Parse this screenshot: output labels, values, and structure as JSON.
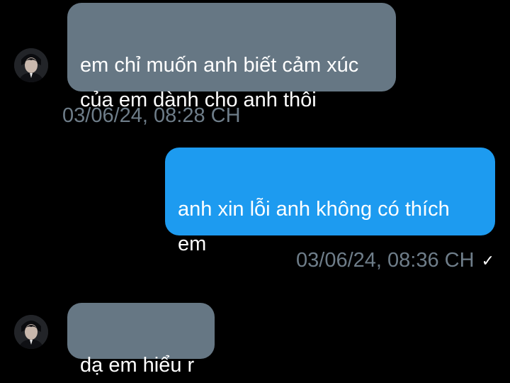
{
  "conversation": {
    "messages": [
      {
        "direction": "received",
        "text": "em chỉ muốn anh biết cảm xúc\ncủa em dành cho anh thôi",
        "timestamp": "03/06/24, 08:28 CH"
      },
      {
        "direction": "sent",
        "text": "anh xin lỗi anh không có thích\nem",
        "timestamp": "03/06/24, 08:36 CH",
        "status_icon": "checkmark-icon"
      },
      {
        "direction": "received",
        "text": "dạ em hiểu r"
      }
    ]
  },
  "colors": {
    "background": "#000000",
    "received_bubble": "#667784",
    "sent_bubble": "#1d9bf0",
    "timestamp_text": "#6e7d89",
    "message_text": "#ffffff"
  }
}
